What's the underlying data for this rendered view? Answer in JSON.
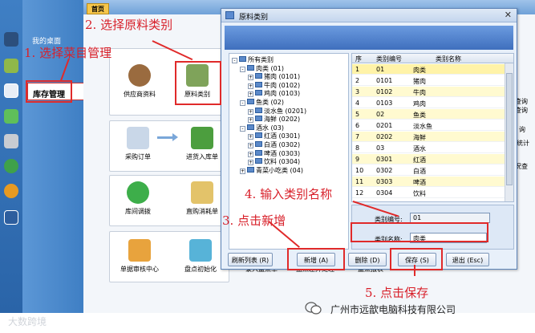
{
  "sidebar": {
    "desktop_label": "我的桌面",
    "active_item": "库存管理"
  },
  "tabs": {
    "home": "首页"
  },
  "tiles": {
    "supplier": "供应商资料",
    "material_category": "原料类别",
    "purchase_order": "采购订单",
    "inbound": "进货入库单",
    "transfer": "库间调拨",
    "direct_consume": "直购消耗单",
    "audit_center": "单据审核中心",
    "stock_init": "盘点初始化",
    "stock_entry": "录入盘点单",
    "stock_diff": "盘点差异处理",
    "stock_report": "盘点报表"
  },
  "right_cut": [
    "查询",
    "查询",
    "询",
    "统计",
    "况查"
  ],
  "dialog": {
    "title": "原料类别",
    "close": "✕",
    "tree": [
      {
        "label": "所有类别",
        "level": 0,
        "sign": "-"
      },
      {
        "label": "肉类 (01)",
        "level": 1,
        "sign": "-"
      },
      {
        "label": "猪肉 (0101)",
        "level": 2,
        "sign": "+"
      },
      {
        "label": "牛肉 (0102)",
        "level": 2,
        "sign": "+"
      },
      {
        "label": "鸡肉 (0103)",
        "level": 2,
        "sign": "+"
      },
      {
        "label": "鱼类 (02)",
        "level": 1,
        "sign": "-"
      },
      {
        "label": "淡水鱼 (0201)",
        "level": 2,
        "sign": "+"
      },
      {
        "label": "海鲜 (0202)",
        "level": 2,
        "sign": "+"
      },
      {
        "label": "酒水 (03)",
        "level": 1,
        "sign": "-"
      },
      {
        "label": "红酒 (0301)",
        "level": 2,
        "sign": "+"
      },
      {
        "label": "白酒 (0302)",
        "level": 2,
        "sign": "+"
      },
      {
        "label": "啤酒 (0303)",
        "level": 2,
        "sign": "+"
      },
      {
        "label": "饮料 (0304)",
        "level": 2,
        "sign": "+"
      },
      {
        "label": "青菜小吃类 (04)",
        "level": 1,
        "sign": "+"
      }
    ],
    "grid": {
      "headers": [
        "序",
        "类别编号",
        "类别名称"
      ],
      "rows": [
        [
          "1",
          "01",
          "肉类"
        ],
        [
          "2",
          "0101",
          "猪肉"
        ],
        [
          "3",
          "0102",
          "牛肉"
        ],
        [
          "4",
          "0103",
          "鸡肉"
        ],
        [
          "5",
          "02",
          "鱼类"
        ],
        [
          "6",
          "0201",
          "淡水鱼"
        ],
        [
          "7",
          "0202",
          "海鲜"
        ],
        [
          "8",
          "03",
          "酒水"
        ],
        [
          "9",
          "0301",
          "红酒"
        ],
        [
          "10",
          "0302",
          "白酒"
        ],
        [
          "11",
          "0303",
          "啤酒"
        ],
        [
          "12",
          "0304",
          "饮料"
        ]
      ]
    },
    "form": {
      "code_label": "类别编号:",
      "code_value": "01",
      "name_label": "类别名称:",
      "name_value": "肉类"
    },
    "buttons": {
      "refresh": "刷新列表 (R)",
      "add": "新增 (A)",
      "delete": "删除 (D)",
      "save": "保存 (S)",
      "exit": "退出 (Esc)"
    }
  },
  "annotations": {
    "step1": "1. 选择菜目管理",
    "step2": "2. 选择原料类别",
    "step3": "3. 点击新增",
    "step4": "4. 输入类别名称",
    "step5": "5. 点击保存"
  },
  "footer": "广州市远歆电脑科技有限公司",
  "watermark": "大数跨境",
  "colors": {
    "annotation": "#d8202a",
    "accent_blue": "#3f7fc4",
    "tab_yellow": "#f6c64a"
  }
}
